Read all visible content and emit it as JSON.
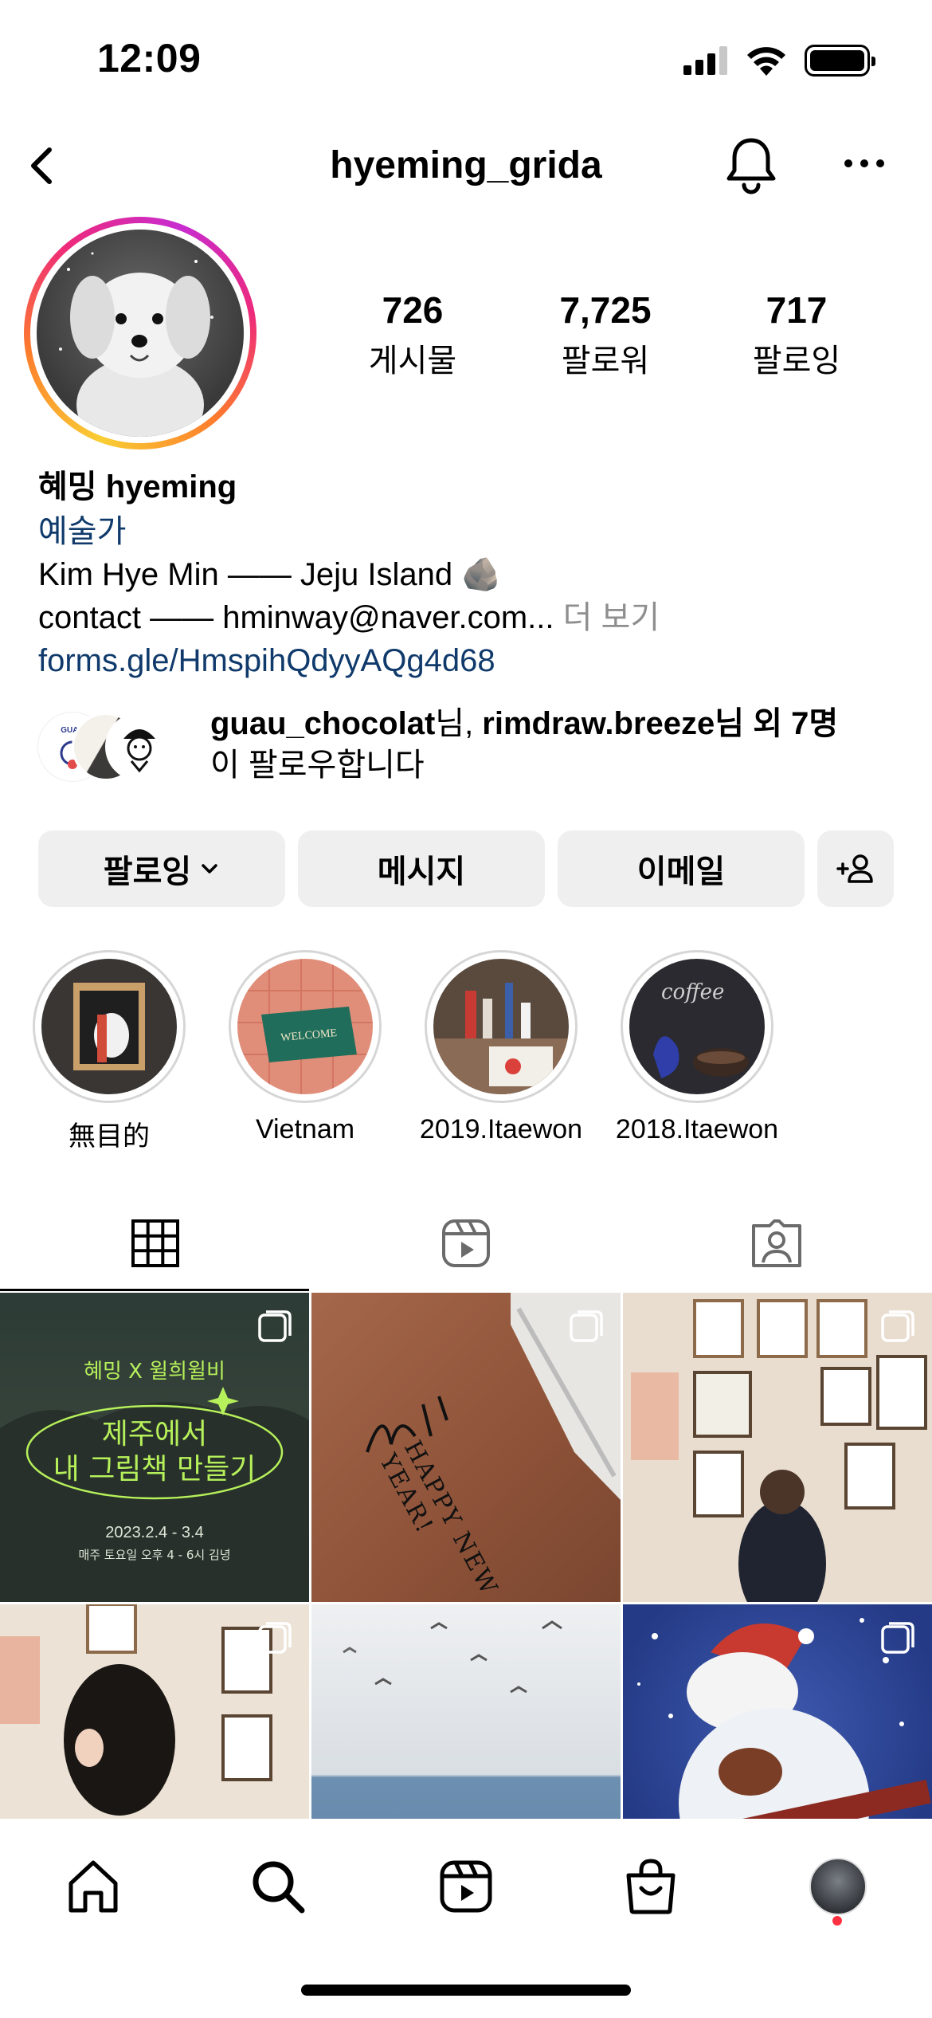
{
  "status_bar": {
    "time": "12:09"
  },
  "header": {
    "username": "hyeming_grida"
  },
  "stats": [
    {
      "value": "726",
      "label": "게시물"
    },
    {
      "value": "7,725",
      "label": "팔로워"
    },
    {
      "value": "717",
      "label": "팔로잉"
    }
  ],
  "bio": {
    "name": "혜밍 hyeming",
    "category": "예술가",
    "line1": "Kim Hye Min —— Jeju Island 🪨",
    "line2": "contact —— hminway@naver.com...",
    "more": " 더 보기",
    "link": "forms.gle/HmspihQdyyAQg4d68"
  },
  "followed_by": {
    "user1": "guau_chocolat",
    "suffix1": "님, ",
    "user2": "rimdraw.breeze",
    "suffix2": "님 외 7명",
    "line2": "이 팔로우합니다"
  },
  "buttons": {
    "following": "팔로잉",
    "message": "메시지",
    "email": "이메일"
  },
  "highlights": [
    {
      "label": "無目的"
    },
    {
      "label": "Vietnam"
    },
    {
      "label": "2019.Itaewon"
    },
    {
      "label": "2018.Itaewon"
    }
  ],
  "posts": {
    "post1": {
      "line_top": "혜밍 X 윌희윌비",
      "title1": "제주에서",
      "title2": "내 그림책 만들기",
      "date": "2023.2.4 - 3.4",
      "time": "매주 토요일 오후 4 - 6시 김녕"
    },
    "post2": {
      "handwriting": "HAPPY NEW YEAR!"
    }
  },
  "colors": {
    "link": "#0f3a6b",
    "button_bg": "#efefef",
    "notification_dot": "#ff3040"
  }
}
